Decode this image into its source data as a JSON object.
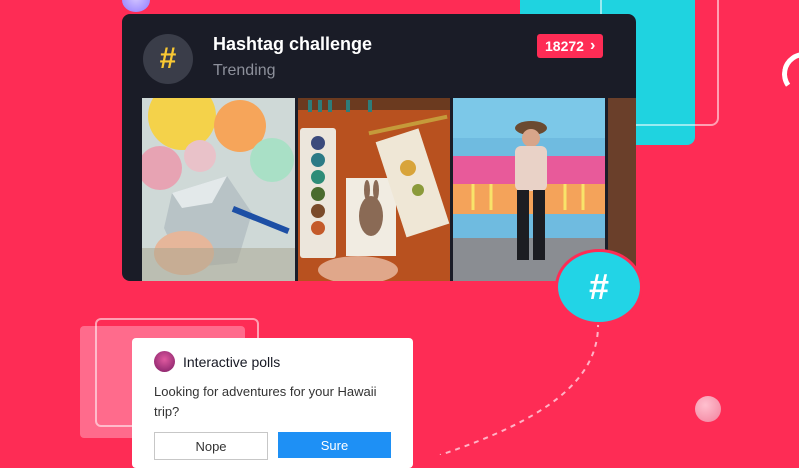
{
  "hashtag_card": {
    "icon": "hashtag-icon",
    "title": "Hashtag challenge",
    "subtitle": "Trending",
    "count": "18272",
    "count_chevron": "›",
    "videos": [
      {
        "name": "video-thumb-pottery-painting"
      },
      {
        "name": "video-thumb-watercolor-rabbit"
      },
      {
        "name": "video-thumb-mural-painting"
      },
      {
        "name": "video-thumb-partial"
      }
    ]
  },
  "hashtag_bubble": {
    "glyph": "#",
    "icon": "hashtag-icon"
  },
  "poll": {
    "title": "Interactive polls",
    "question": "Looking for adventures for your Hawaii trip?",
    "options": [
      "Nope",
      "Sure"
    ]
  },
  "colors": {
    "background": "#fe2c55",
    "card": "#1a1c27",
    "accent_cyan": "#22d4e6",
    "badge": "#fe2c55",
    "sure_button": "#1e90f5",
    "hashtag_yellow": "#f9c833"
  }
}
